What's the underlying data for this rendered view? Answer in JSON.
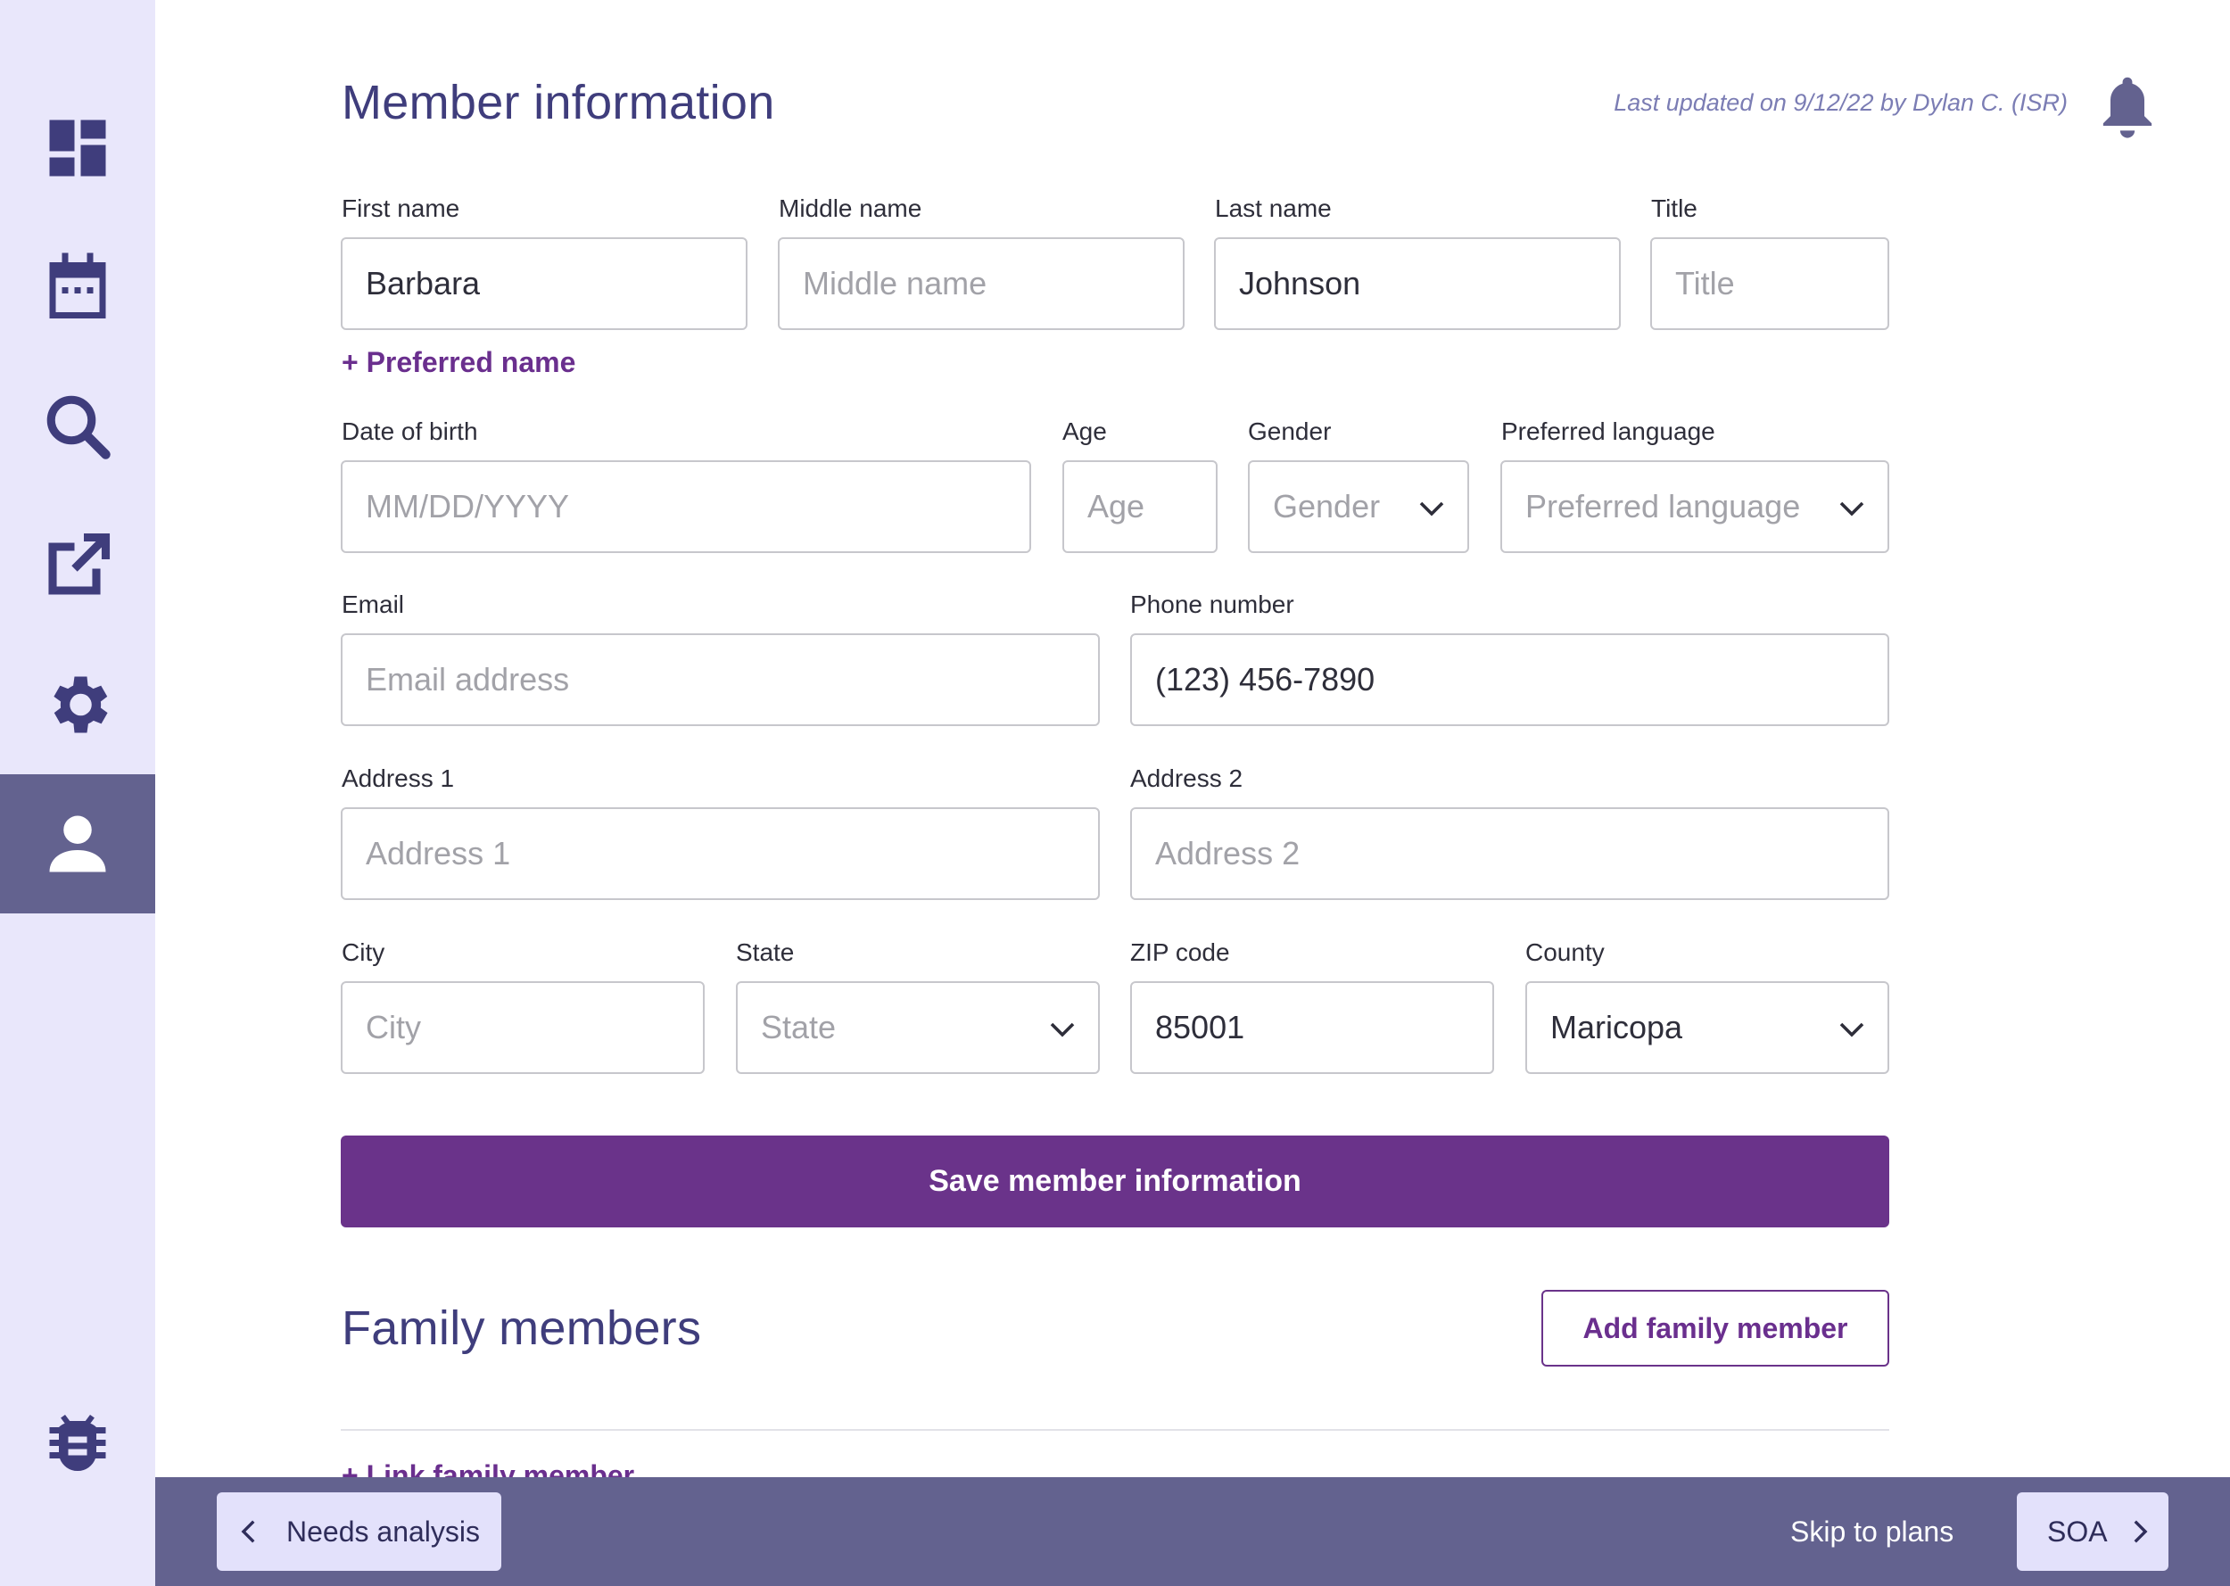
{
  "colors": {
    "sidebar_bg": "#e9e7fb",
    "active_bg": "#63628f",
    "icon": "#3f3d7c",
    "accent": "#6a338a",
    "footer_bg": "#63628f"
  },
  "sidebar": {
    "items": [
      {
        "icon": "dashboard-icon"
      },
      {
        "icon": "calendar-icon"
      },
      {
        "icon": "search-icon"
      },
      {
        "icon": "external-link-icon"
      },
      {
        "icon": "gear-icon"
      },
      {
        "icon": "user-icon",
        "active": true
      },
      {
        "icon": "bug-icon"
      }
    ]
  },
  "header": {
    "title": "Member information",
    "last_updated": "Last updated on 9/12/22 by Dylan C. (ISR)",
    "bell_icon": "bell-icon"
  },
  "form": {
    "first_name": {
      "label": "First name",
      "value": "Barbara"
    },
    "middle_name": {
      "label": "Middle name",
      "placeholder": "Middle name"
    },
    "last_name": {
      "label": "Last name",
      "value": "Johnson"
    },
    "title": {
      "label": "Title",
      "placeholder": "Title"
    },
    "preferred_name_link": "+ Preferred name",
    "dob": {
      "label": "Date of birth",
      "placeholder": "MM/DD/YYYY"
    },
    "age": {
      "label": "Age",
      "placeholder": "Age"
    },
    "gender": {
      "label": "Gender",
      "placeholder": "Gender"
    },
    "preferred_language": {
      "label": "Preferred language",
      "placeholder": "Preferred language"
    },
    "email": {
      "label": "Email",
      "placeholder": "Email address"
    },
    "phone": {
      "label": "Phone number",
      "value": "(123) 456-7890"
    },
    "address1": {
      "label": "Address 1",
      "placeholder": "Address 1"
    },
    "address2": {
      "label": "Address 2",
      "placeholder": "Address 2"
    },
    "city": {
      "label": "City",
      "placeholder": "City"
    },
    "state": {
      "label": "State",
      "placeholder": "State"
    },
    "zip": {
      "label": "ZIP code",
      "value": "85001"
    },
    "county": {
      "label": "County",
      "value": "Maricopa"
    },
    "save_label": "Save member information"
  },
  "family": {
    "title": "Family members",
    "add_label": "Add family member",
    "link_label": "+ Link family member"
  },
  "footer": {
    "back_label": "Needs analysis",
    "skip_label": "Skip to plans",
    "next_label": "SOA"
  }
}
